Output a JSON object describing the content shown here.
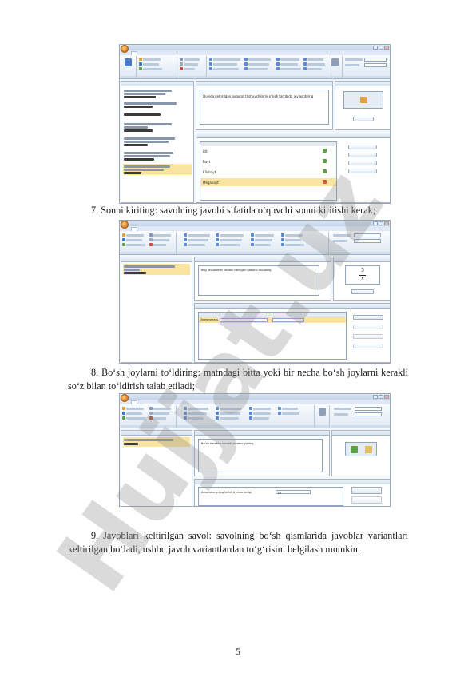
{
  "paragraphs": {
    "p7": "7. Sonni kiriting: savolning javobi sifatida o‘quvchi sonni kiritishi kerak;",
    "p8": "8. Bo‘sh joylarni to‘ldiring: matndagi bitta yoki bir necha bo‘sh joylarni kerakli so‘z bilan to‘ldirish talab etiladi;",
    "p9": "9. Javoblari keltirilgan savol: savolning bo‘sh qismlarida javoblar variantlari keltirilgan bo‘ladi, ushbu javob variantlardan to‘g‘risini belgilash mumkin."
  },
  "page_number": "5",
  "watermark": {
    "text": "Hujjat.uz",
    "color_gray": "#8c8c8c",
    "color_yellow": "#f0c020",
    "color_purple": "#9b7fd8"
  },
  "shot1": {
    "question_text": "Quyida keltirilgan axborot tashuvchilarni o‘sish tartibida joylashtiring",
    "answers": [
      "Bit",
      "Bayt",
      "Kilobayt",
      "Megabayt"
    ]
  },
  "shot2": {
    "question_text": "eng aniqlanishi oshadi berilgan qabaho aniqlang",
    "fraction_num": "5",
    "fraction_den": "x",
    "answer_label": "Знаменатель"
  },
  "shot3": {
    "question_text": "Bo‘sh katakka kerakli javobni yozing",
    "blank_label": "Axborotning eng kichik o‘lchov birligi",
    "blank_value": "bit"
  },
  "colors": {
    "ribbon_blue": "#dfe8f3",
    "selection": "#f7dc8f",
    "panel_border": "#a6b6ca"
  }
}
